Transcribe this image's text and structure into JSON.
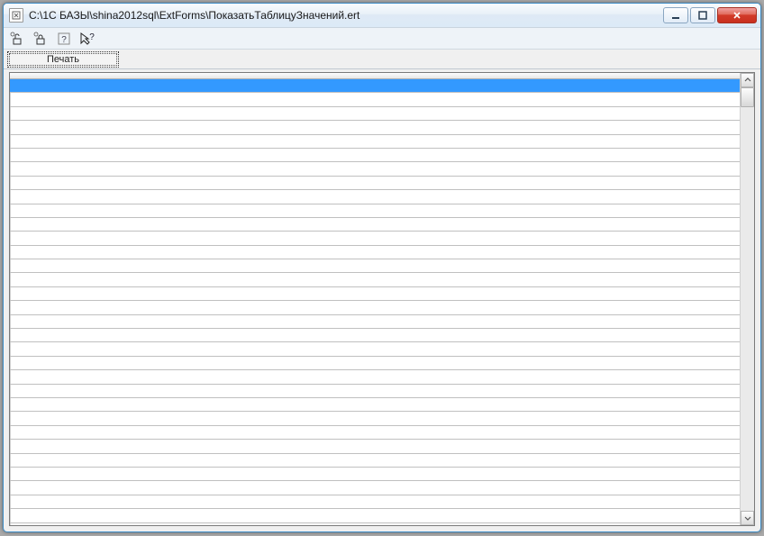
{
  "window": {
    "title": "C:\\1С БАЗЫ\\shina2012sql\\ExtForms\\ПоказатьТаблицуЗначений.ert"
  },
  "toolbar": {
    "icons": {
      "lock_open": "lock-open-icon",
      "lock_closed": "lock-closed-icon",
      "help": "help-icon",
      "context_help": "context-help-icon"
    }
  },
  "buttons": {
    "print_label": "Печать"
  },
  "grid": {
    "row_count": 32,
    "selected_index": 0
  },
  "colors": {
    "selection": "#3399ff",
    "window_border": "#3b8bc5",
    "close_button": "#d23b2a"
  }
}
